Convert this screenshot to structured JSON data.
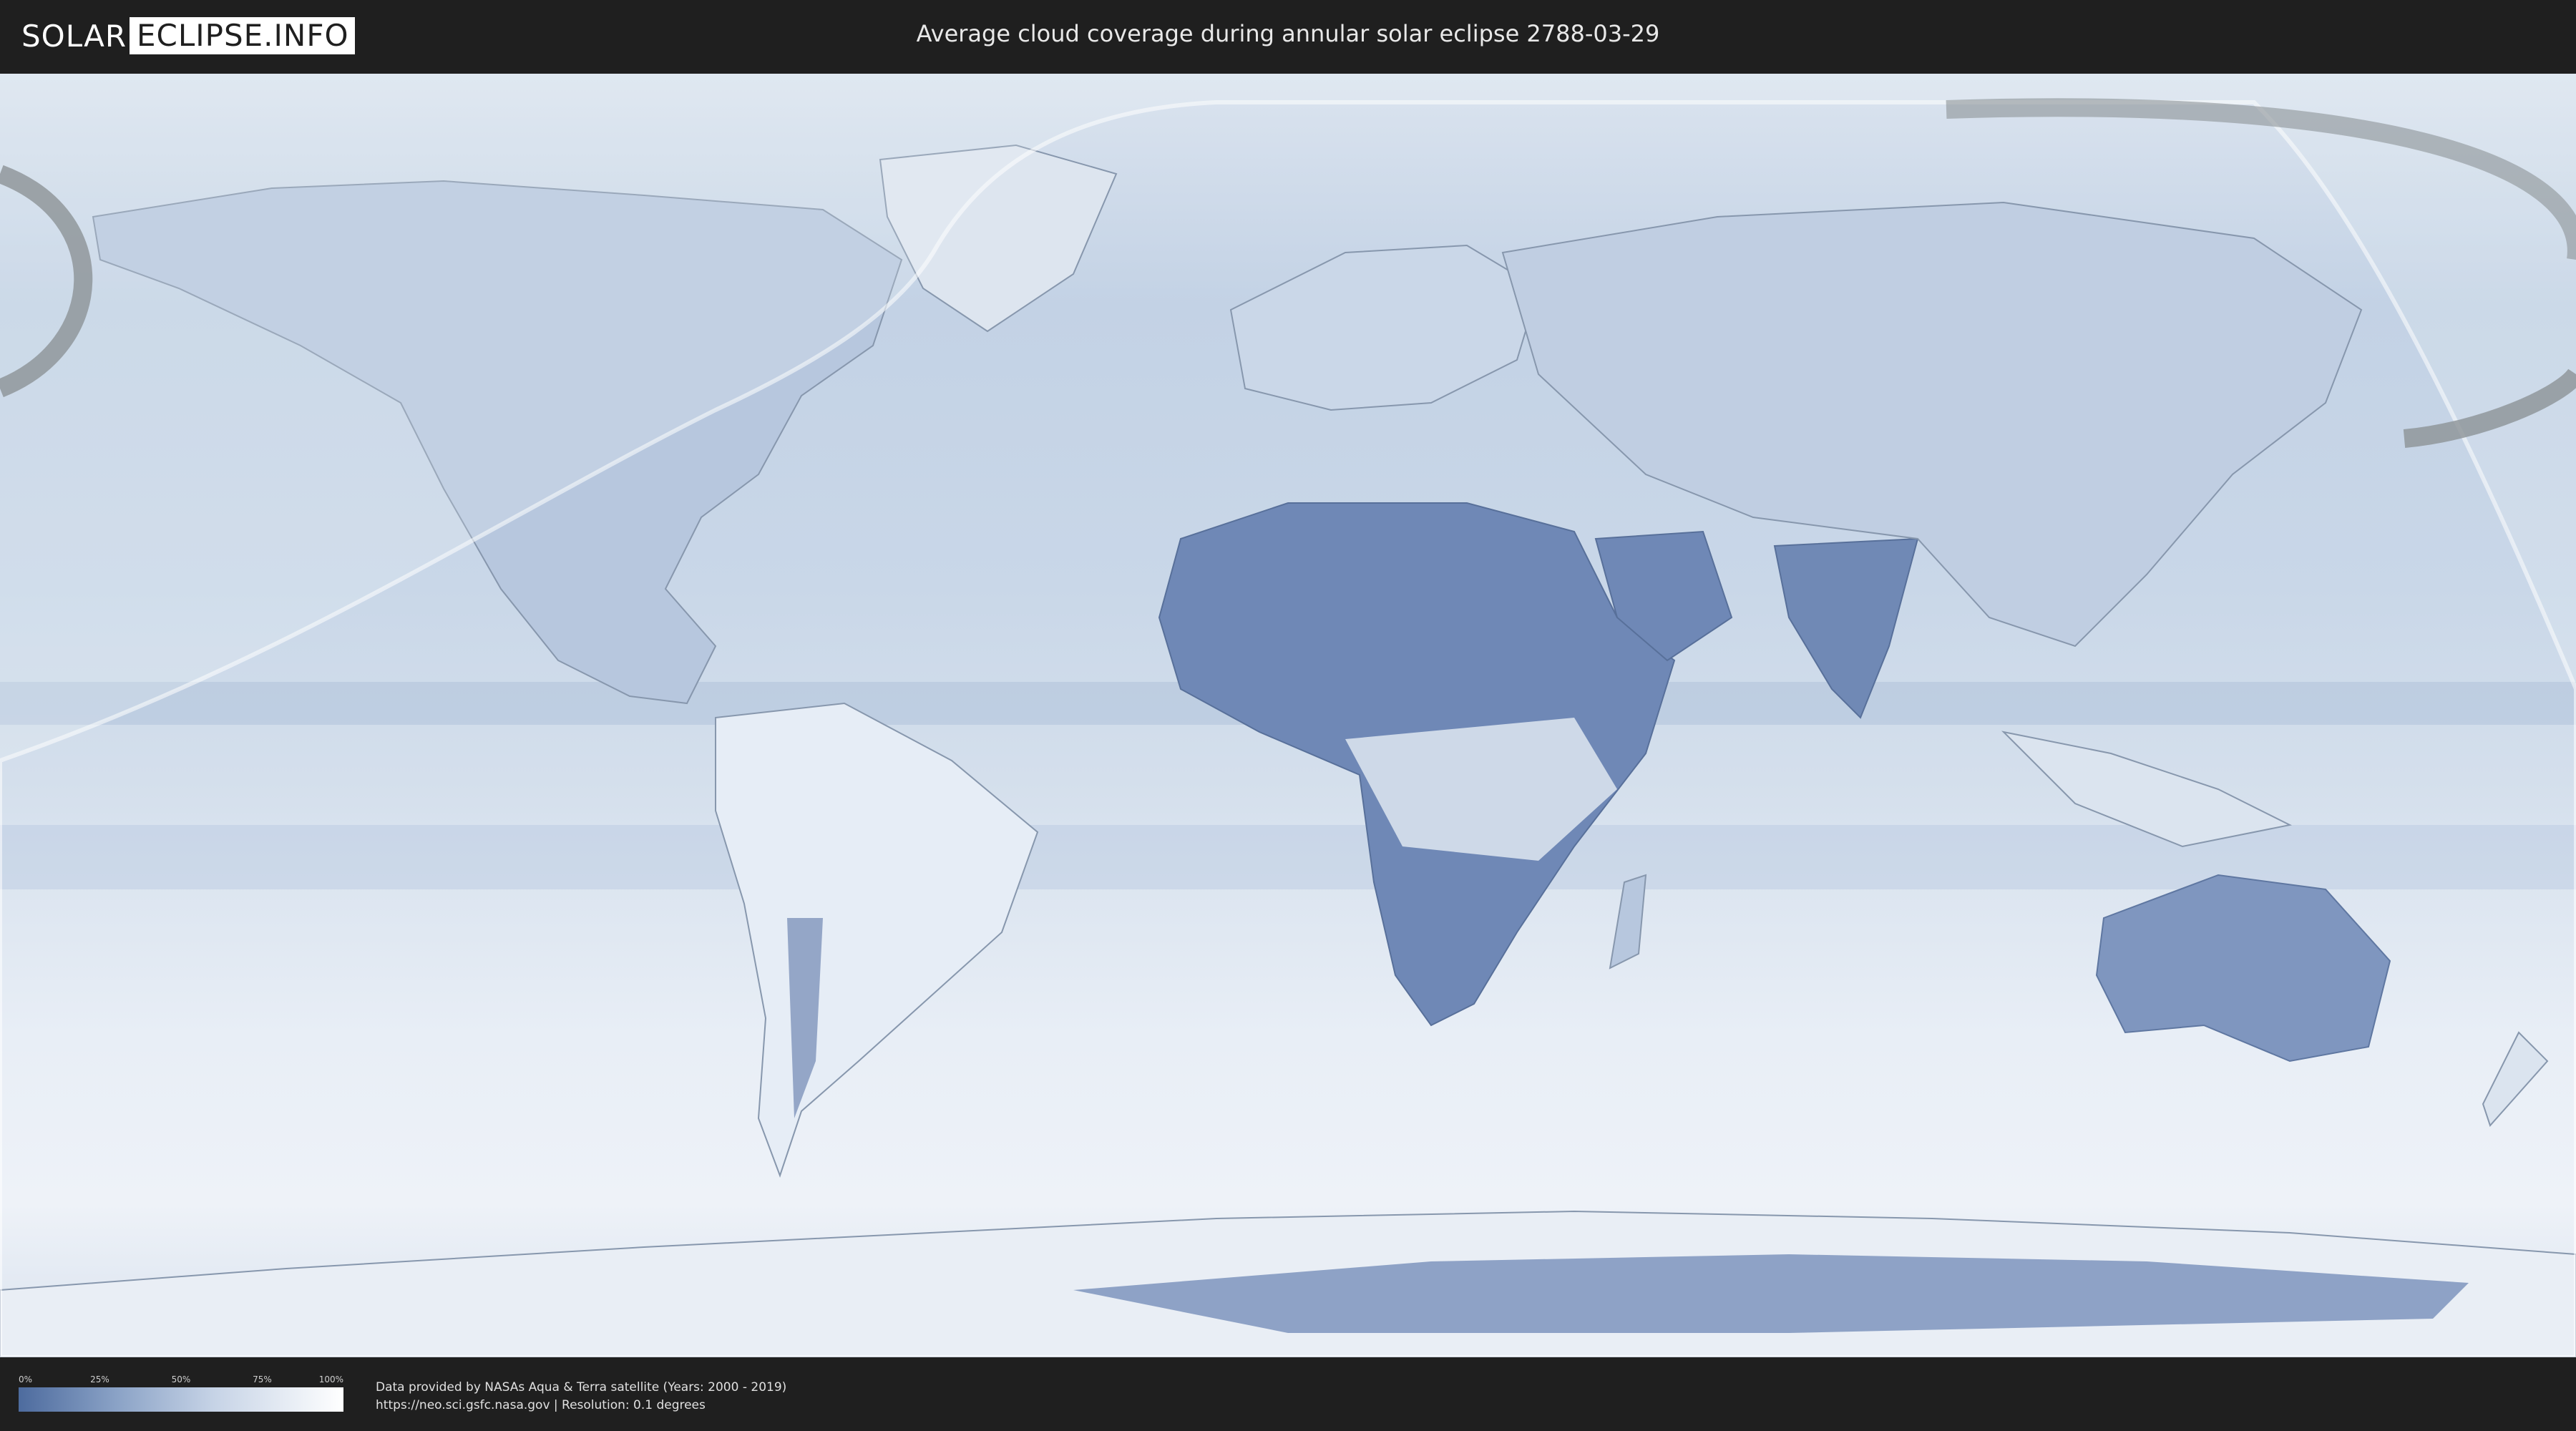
{
  "header": {
    "logo_part1": "SOLAR",
    "logo_part2": "ECLIPSE.INFO",
    "title": "Average cloud coverage during annular solar eclipse 2788-03-29"
  },
  "map": {
    "ocean_color": "#c9d6e6",
    "land_clear_color": "#5a77a8",
    "land_cloudy_color": "#eef3f9",
    "eclipse_band_color": "#e8ecef",
    "path_edge_color": "#8c9296",
    "icons": [
      "world-map",
      "eclipse-visibility-zone",
      "eclipse-path-arc"
    ]
  },
  "footer": {
    "legend": {
      "ticks": [
        "0%",
        "25%",
        "50%",
        "75%",
        "100%"
      ],
      "colors": [
        "#4d6b9e",
        "#ffffff"
      ]
    },
    "credit_line1": "Data provided by NASAs Aqua & Terra satellite (Years: 2000 - 2019)",
    "credit_line2": "https://neo.sci.gsfc.nasa.gov | Resolution: 0.1 degrees"
  }
}
